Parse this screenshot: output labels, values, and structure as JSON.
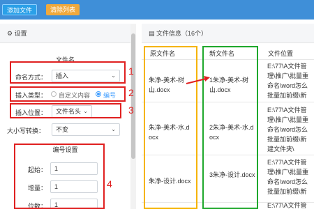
{
  "toolbar": {
    "add_label": "添加文件",
    "clear_label": "清除列表"
  },
  "settings": {
    "title": "设置",
    "section_title": "文件名",
    "naming": {
      "label": "命名方式：",
      "value": "插入"
    },
    "insert_type": {
      "label": "插入类型：",
      "options": [
        "自定义内容",
        "编号"
      ],
      "selected": "编号"
    },
    "insert_pos": {
      "label": "插入位置：",
      "value": "文件名头"
    },
    "case": {
      "label": "大小写转换：",
      "value": "不变"
    },
    "numbering": {
      "title": "编号设置",
      "start_label": "起始：",
      "start_value": "1",
      "step_label": "增量：",
      "step_value": "1",
      "digits_label": "位数：",
      "digits_value": "1"
    }
  },
  "annotations": [
    "1",
    "2",
    "3",
    "4"
  ],
  "file_info": {
    "title": "文件信息（16个）",
    "headers": {
      "orig": "原文件名",
      "new": "新文件名",
      "loc": "文件位置"
    },
    "rows": [
      {
        "orig": [
          "朱净-美术-树",
          "山.docx"
        ],
        "new": [
          "1朱净-美术-树",
          "山.docx"
        ],
        "loc": [
          "E:\\77\\A文件管",
          "理\\推广\\批量重",
          "命名\\word怎么",
          "批量加前缀\\新",
          "建文件夹\\"
        ]
      },
      {
        "orig": [
          "朱净-美术-水.d",
          "ocx"
        ],
        "new": [
          "2朱净-美术-水.d",
          "ocx"
        ],
        "loc": [
          "E:\\77\\A文件管",
          "理\\推广\\批量重",
          "命名\\word怎么",
          "批量加前缀\\新",
          "建文件夹\\"
        ]
      },
      {
        "orig": [
          "朱净-设计.docx"
        ],
        "new": [
          "3朱净-设计.docx"
        ],
        "loc": [
          "E:\\77\\A文件管",
          "理\\推广\\批量重",
          "命名\\word怎么",
          "批量加前缀\\新",
          "建文件夹\\"
        ]
      },
      {
        "orig": [
          ""
        ],
        "new": [
          ""
        ],
        "loc": [
          "E:\\77\\A文件管"
        ]
      }
    ]
  },
  "colors": {
    "toolbar_bg": "#3f8fd8",
    "accent": "#409eff",
    "annotation_red": "#e02020",
    "orig_box": "#f5b400",
    "new_box": "#1fa82c"
  }
}
